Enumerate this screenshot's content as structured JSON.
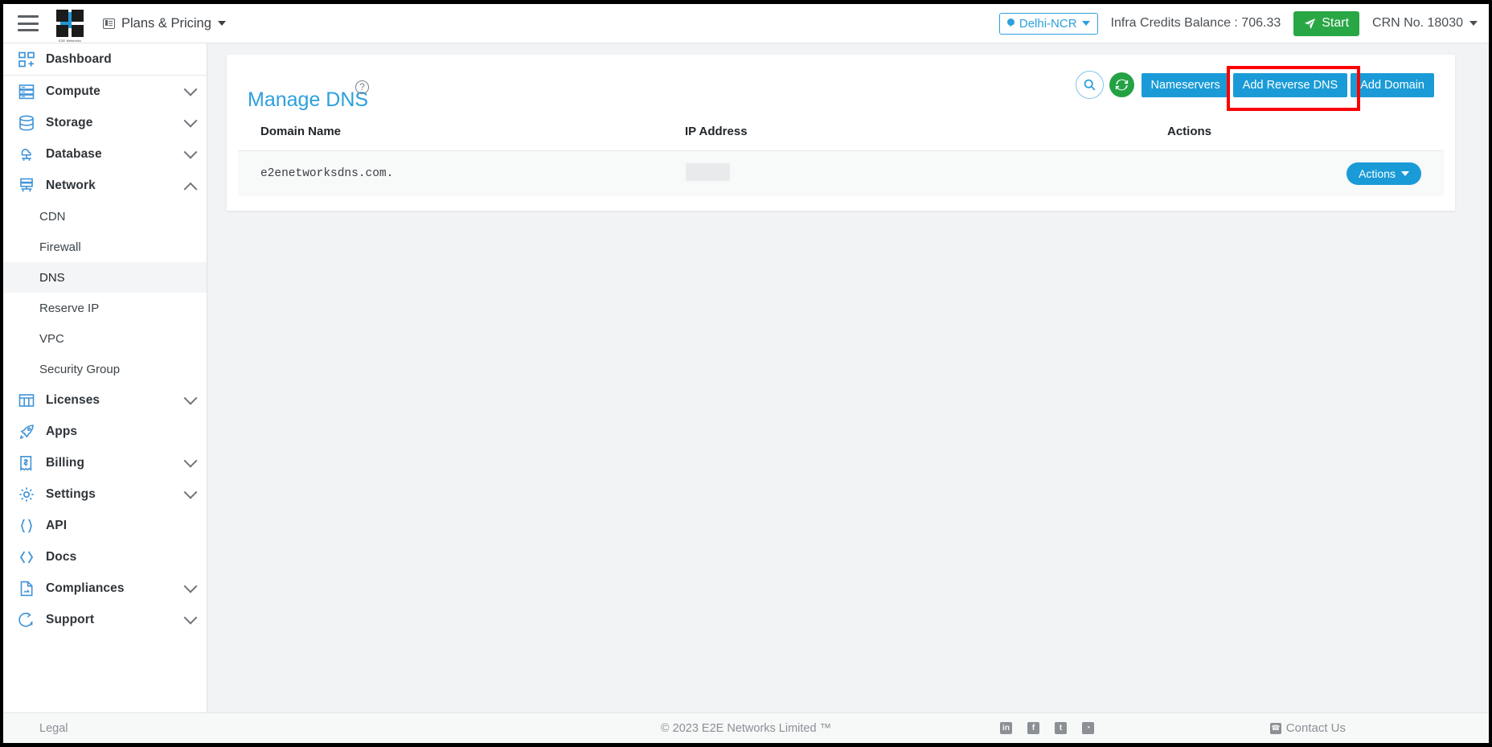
{
  "topbar": {
    "menu_icon": "hamburger-menu-icon",
    "logo_caption": "E2E Networks",
    "plans_label": "Plans & Pricing",
    "region": "Delhi-NCR",
    "credits_label": "Infra Credits Balance : 706.33",
    "start_label": "Start",
    "crn_label": "CRN No. 18030"
  },
  "sidebar": {
    "items": [
      {
        "label": "Dashboard",
        "icon": "dashboard-icon",
        "expandable": false
      },
      {
        "label": "Compute",
        "icon": "server-icon",
        "expandable": true,
        "expanded": false
      },
      {
        "label": "Storage",
        "icon": "database-stack-icon",
        "expandable": true,
        "expanded": false
      },
      {
        "label": "Database",
        "icon": "cloud-database-icon",
        "expandable": true,
        "expanded": false
      },
      {
        "label": "Network",
        "icon": "network-icon",
        "expandable": true,
        "expanded": true
      },
      {
        "label": "Licenses",
        "icon": "license-grid-icon",
        "expandable": true,
        "expanded": false
      },
      {
        "label": "Apps",
        "icon": "rocket-icon",
        "expandable": false
      },
      {
        "label": "Billing",
        "icon": "invoice-dollar-icon",
        "expandable": true,
        "expanded": false
      },
      {
        "label": "Settings",
        "icon": "gear-icon",
        "expandable": true,
        "expanded": false
      },
      {
        "label": "API",
        "icon": "braces-icon",
        "expandable": false
      },
      {
        "label": "Docs",
        "icon": "code-brackets-icon",
        "expandable": false
      },
      {
        "label": "Compliances",
        "icon": "document-icon",
        "expandable": true,
        "expanded": false
      },
      {
        "label": "Support",
        "icon": "support-chat-icon",
        "expandable": true,
        "expanded": false
      }
    ],
    "network_children": [
      {
        "label": "CDN",
        "active": false
      },
      {
        "label": "Firewall",
        "active": false
      },
      {
        "label": "DNS",
        "active": true
      },
      {
        "label": "Reserve IP",
        "active": false
      },
      {
        "label": "VPC",
        "active": false
      },
      {
        "label": "Security Group",
        "active": false
      }
    ]
  },
  "main": {
    "page_title": "Manage DNS",
    "help_icon": "question-mark-icon",
    "toolbar": {
      "search_icon": "search-icon",
      "refresh_icon": "refresh-icon",
      "nameservers_label": "Nameservers",
      "add_reverse_dns_label": "Add Reverse DNS",
      "add_domain_label": "Add Domain"
    },
    "table": {
      "columns": [
        "Domain Name",
        "IP Address",
        "Actions"
      ],
      "rows": [
        {
          "domain_name": "e2enetworksdns.com.",
          "ip_address": "",
          "ip_redacted": true,
          "action_label": "Actions"
        }
      ]
    }
  },
  "footer": {
    "legal_label": "Legal",
    "copyright": "© 2023 E2E Networks Limited ™",
    "social": [
      {
        "name": "linkedin-icon",
        "glyph": "in"
      },
      {
        "name": "facebook-icon",
        "glyph": "f"
      },
      {
        "name": "twitter-icon",
        "glyph": "t"
      },
      {
        "name": "rss-icon",
        "glyph": "◔"
      }
    ],
    "contact_label": "Contact Us"
  },
  "colors": {
    "accent_blue": "#2ca0dd",
    "button_blue": "#1a9bd7",
    "green": "#23a244",
    "highlight_red": "#fc0000"
  }
}
